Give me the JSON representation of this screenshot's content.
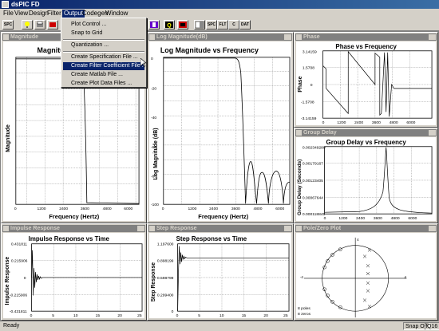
{
  "app": {
    "title": "dsPIC FD"
  },
  "menu": {
    "items": [
      "File",
      "View",
      "Design",
      "Filter",
      "Output",
      "Codegen",
      "Window"
    ],
    "active": "Output"
  },
  "toolbar": {
    "buttons": [
      "SPC",
      "FLT",
      "C",
      "DAT"
    ]
  },
  "dropdown": {
    "items": [
      "Plot Control ...",
      "Snap to Grid",
      "Quantization ...",
      "Create Specification File ...",
      "Create Filter Coefficient File ...",
      "Create Matlab File ...",
      "Create Plot Data Files ..."
    ],
    "highlighted": "Create Filter Coefficient File ..."
  },
  "windows": {
    "magnitude": {
      "title": "Magnitude",
      "plot_title": "Magnitude vs Frequency",
      "visible_title": "Magnitu",
      "xlabel": "Frequency (Hertz)",
      "ylabel": "Magnitude"
    },
    "logmag": {
      "title": "Log Magnitude(dB)",
      "plot_title": "Log Magnitude vs Frequency",
      "xlabel": "Frequency (Hertz)",
      "ylabel": "Log Magnitude (dB)"
    },
    "phase": {
      "title": "Phase",
      "plot_title": "Phase vs Frequency",
      "ylabel": "Phase"
    },
    "groupdelay": {
      "title": "Group Delay",
      "plot_title": "Group Delay vs Frequency",
      "ylabel": "Group Delay (Seconds)"
    },
    "impulse": {
      "title": "Impulse Response",
      "plot_title": "Impulse Response vs Time",
      "ylabel": "Impulse Response"
    },
    "step": {
      "title": "Step Response",
      "plot_title": "Step Response vs Time",
      "ylabel": "Step Response"
    },
    "polezero": {
      "title": "Pole/Zero Plot",
      "poles_text": "8 poles",
      "zeros_text": "8 zeros"
    }
  },
  "chart_data": [
    {
      "type": "line",
      "title": "Magnitude vs Frequency",
      "xlabel": "Frequency (Hertz)",
      "ylabel": "Magnitude",
      "x_ticks": [
        "0",
        "1200",
        "2400",
        "3600",
        "4800",
        "6000"
      ],
      "xlim": [
        0,
        6000
      ]
    },
    {
      "type": "line",
      "title": "Log Magnitude vs Frequency",
      "xlabel": "Frequency (Hertz)",
      "ylabel": "Log Magnitude (dB)",
      "x_ticks": [
        "0",
        "1200",
        "2400",
        "3600",
        "4800",
        "6000"
      ],
      "y_ticks": [
        "0",
        "-20",
        "-40",
        "-60",
        "-80",
        "-100"
      ],
      "xlim": [
        0,
        6000
      ],
      "ylim": [
        -100,
        0
      ]
    },
    {
      "type": "line",
      "title": "Phase vs Frequency",
      "ylabel": "Phase",
      "x_ticks": [
        "0",
        "1200",
        "2400",
        "3600",
        "4800",
        "6000"
      ],
      "y_ticks": [
        "3.14159",
        "1.5708",
        "0",
        "-1.5708",
        "-3.14159"
      ],
      "ylim": [
        -3.14159,
        3.14159
      ]
    },
    {
      "type": "line",
      "title": "Group Delay vs Frequency",
      "ylabel": "Group Delay (Seconds)",
      "x_ticks": [
        "0",
        "1200",
        "2400",
        "3600",
        "4800",
        "6000"
      ],
      "y_ticks": [
        "0.002349280",
        "0.00179167",
        "0.00123405",
        "0.00067644",
        "0.000118845"
      ]
    },
    {
      "type": "line",
      "title": "Impulse Response vs Time",
      "ylabel": "Impulse Response",
      "x_ticks": [
        "0",
        "5",
        "10",
        "15",
        "20",
        "25"
      ],
      "y_ticks": [
        "0.431811",
        "0.215906",
        "0",
        "-0.215906",
        "-0.431811"
      ],
      "ylim": [
        -0.431811,
        0.431811
      ]
    },
    {
      "type": "line",
      "title": "Step Response vs Time",
      "ylabel": "Step Response",
      "x_ticks": [
        "0",
        "5",
        "10",
        "15",
        "20",
        "25"
      ],
      "y_ticks": [
        "1.197600",
        "0.898199",
        "0.598799",
        "0.299400",
        "0"
      ],
      "ylim": [
        0,
        1.1976
      ]
    },
    {
      "type": "scatter",
      "title": "Pole/Zero Plot",
      "annotations": [
        "8 poles",
        "8 zeros"
      ]
    }
  ],
  "status": {
    "left": "Ready",
    "snap": "Snap Off",
    "code": "Q16"
  }
}
